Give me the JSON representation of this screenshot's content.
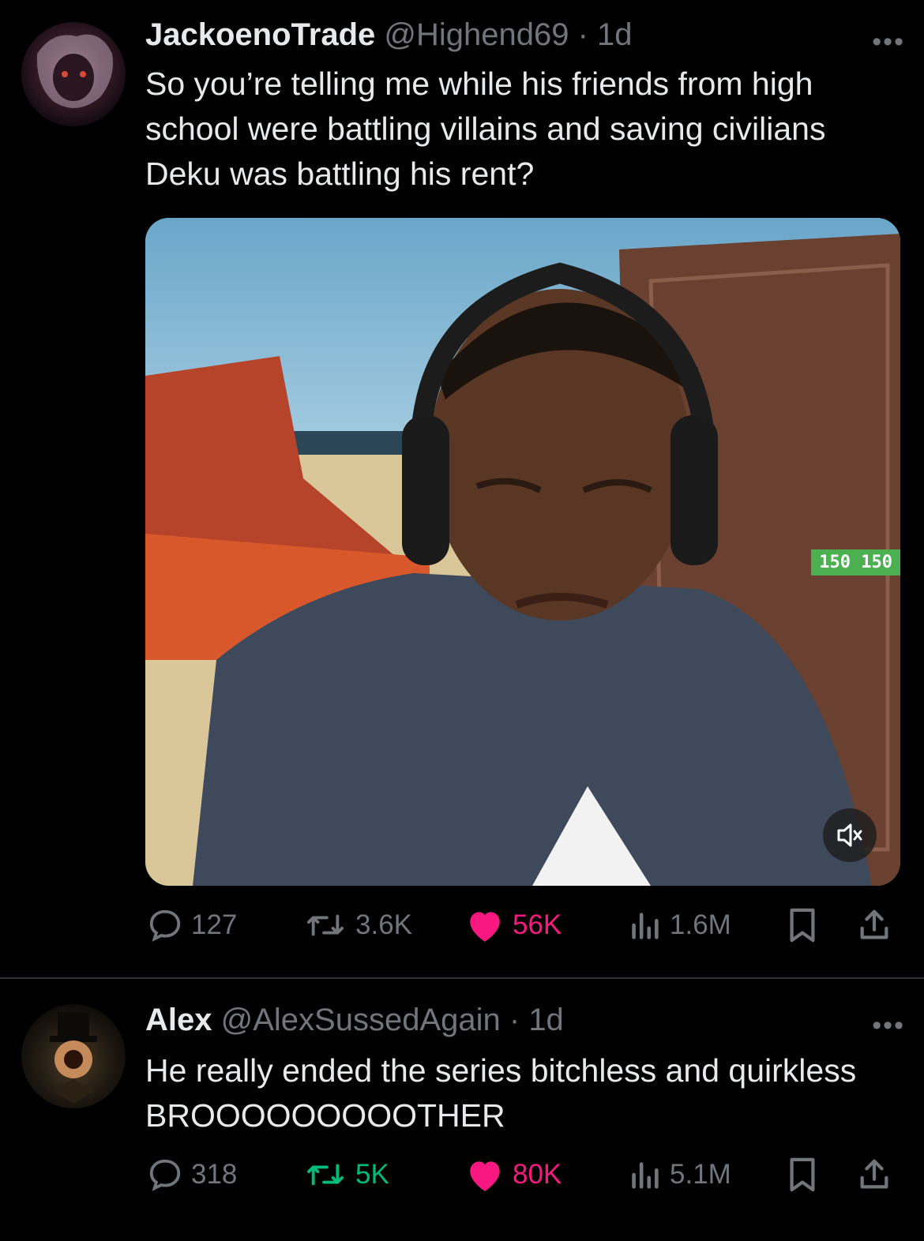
{
  "tweets": [
    {
      "name": "JackoenoTrade",
      "handle": "@Highend69",
      "time": "1d",
      "text": "So you’re telling me while his friends from high school were battling villains and saving civilians Deku was battling his rent?",
      "media": {
        "overlay_score": "150  150"
      },
      "replies": "127",
      "retweets": "3.6K",
      "likes": "56K",
      "views": "1.6M"
    },
    {
      "name": "Alex",
      "handle": "@AlexSussedAgain",
      "time": "1d",
      "text": "He really ended the series bitchless and quirkless BROOOOOOOOOTHER",
      "replies": "318",
      "retweets": "5K",
      "likes": "80K",
      "views": "5.1M"
    }
  ],
  "icons": {
    "reply": "reply-icon",
    "retweet": "retweet-icon",
    "like": "heart-icon",
    "views": "views-icon",
    "bookmark": "bookmark-icon",
    "share": "share-icon",
    "more": "more-icon",
    "mute": "mute-icon"
  },
  "colors": {
    "background": "#000000",
    "text": "#e7e9ea",
    "muted": "#71767b",
    "like": "#f91880",
    "retweet": "#00ba7c"
  }
}
